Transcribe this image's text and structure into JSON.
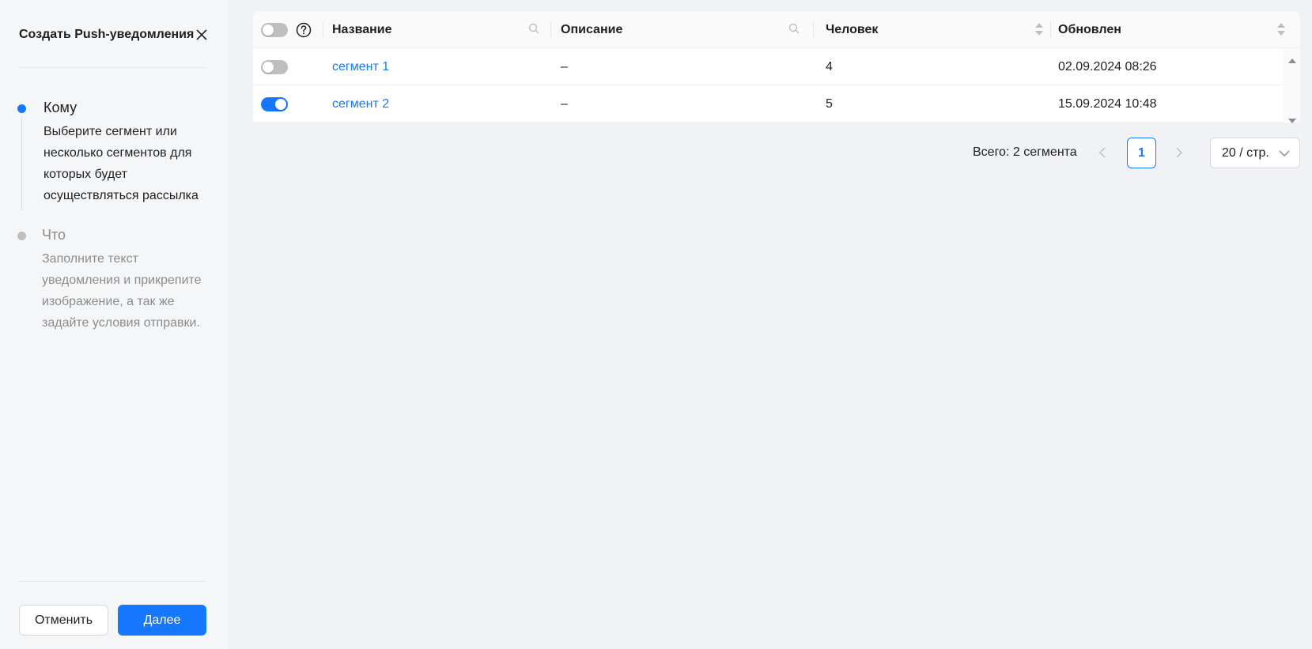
{
  "sidebar": {
    "title": "Создать Push-уведомления",
    "steps": [
      {
        "title": "Кому",
        "description": "Выберите сегмент или несколько сегментов для которых будет осуществляться рассылка",
        "status": "active"
      },
      {
        "title": "Что",
        "description": "Заполните текст уведомления и прикрепите изображение, а так же задайте условия отправки.",
        "status": "wait"
      }
    ],
    "cancel_label": "Отменить",
    "next_label": "Далее"
  },
  "table": {
    "select_all_on": false,
    "columns": [
      {
        "label": "Название",
        "control": "search-icon"
      },
      {
        "label": "Описание",
        "control": "search-icon"
      },
      {
        "label": "Человек",
        "control": "sort-icon"
      },
      {
        "label": "Обновлен",
        "control": "sort-icon"
      }
    ],
    "rows": [
      {
        "selected": false,
        "name": "сегмент 1",
        "description": "–",
        "people": "4",
        "updated": "02.09.2024 08:26"
      },
      {
        "selected": true,
        "name": "сегмент 2",
        "description": "–",
        "people": "5",
        "updated": "15.09.2024 10:48"
      }
    ]
  },
  "pagination": {
    "total_text": "Всего: 2 сегмента",
    "current_page": "1",
    "page_size": "20 / стр."
  },
  "colors": {
    "primary": "#1677ff",
    "switch_off": "#bfbfbf",
    "muted_text": "#8c8c8c",
    "background": "#f0f2f5"
  }
}
